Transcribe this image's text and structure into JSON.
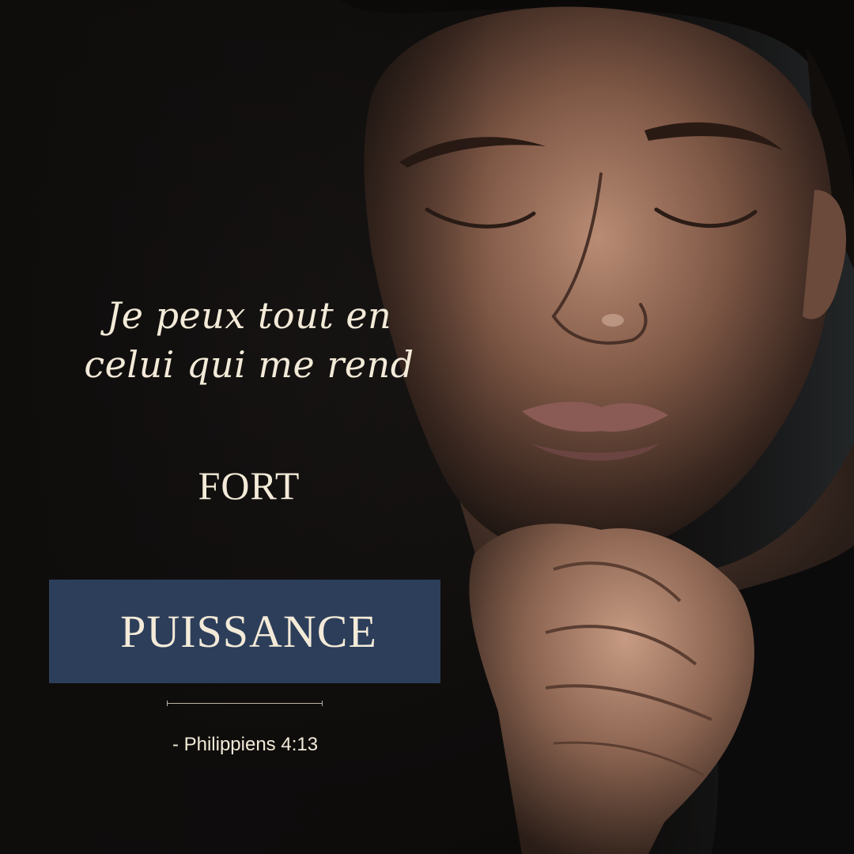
{
  "quote": {
    "line1": "Je peux tout en",
    "line2": "celui qui me rend"
  },
  "keyword": "FORT",
  "banner": {
    "label": "PUISSANCE",
    "color": "#2c3e5a"
  },
  "reference": "- Philippiens 4:13",
  "colors": {
    "text": "#f3ead8",
    "background": "#0e0c0b"
  }
}
